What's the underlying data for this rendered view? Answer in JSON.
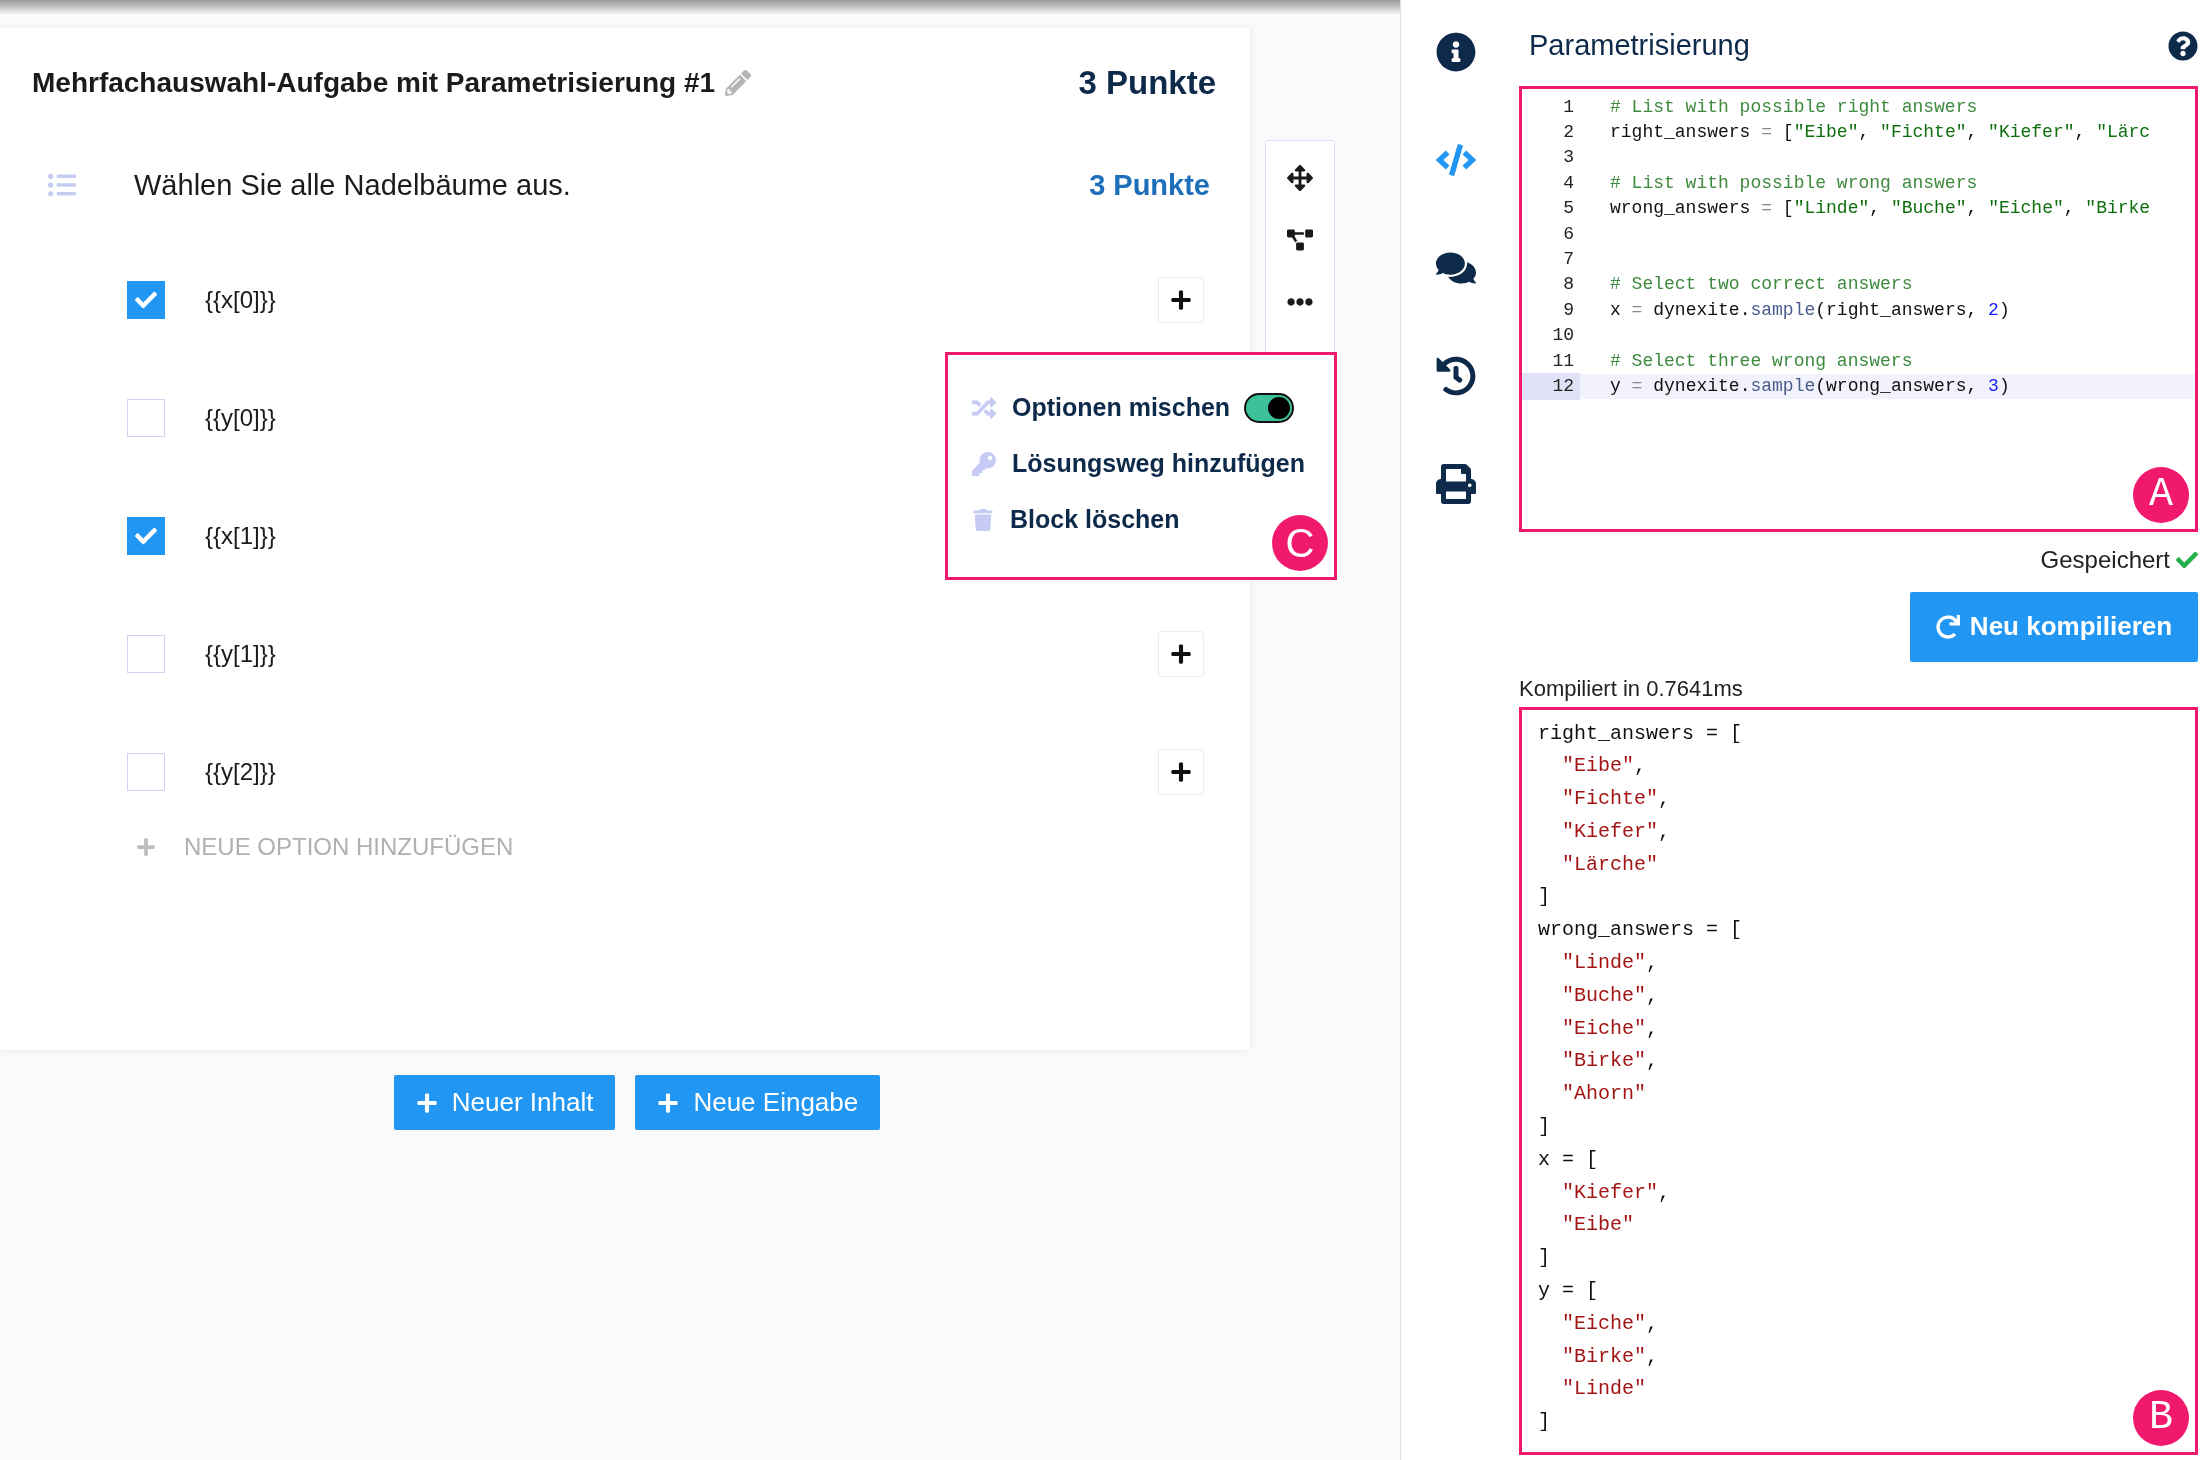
{
  "card": {
    "title": "Mehrfachauswahl-Aufgabe mit Parametrisierung #1",
    "points": "3 Punkte"
  },
  "question": {
    "text": "Wählen Sie alle Nadelbäume aus.",
    "points": "3 Punkte"
  },
  "options": [
    {
      "text": "{{x[0]}}",
      "checked": true
    },
    {
      "text": "{{y[0]}}",
      "checked": false
    },
    {
      "text": "{{x[1]}}",
      "checked": true
    },
    {
      "text": "{{y[1]}}",
      "checked": false
    },
    {
      "text": "{{y[2]}}",
      "checked": false
    }
  ],
  "new_option": "NEUE OPTION HINZUFÜGEN",
  "toolbar": [
    {
      "kind": "move"
    },
    {
      "kind": "diagram"
    },
    {
      "kind": "more"
    }
  ],
  "menu": {
    "badge": "C",
    "items": [
      {
        "kind": "shuffle",
        "text": "Optionen mischen",
        "on": true
      },
      {
        "kind": "solution",
        "text": "Lösungsweg hinzufügen"
      },
      {
        "kind": "delete",
        "text": "Block löschen"
      }
    ]
  },
  "buttons": [
    "Neuer Inhalt",
    "Neue Eingabe"
  ],
  "sidebar": [
    {
      "kind": "info",
      "selected": false
    },
    {
      "kind": "code",
      "selected": true
    },
    {
      "kind": "comments",
      "selected": false
    },
    {
      "kind": "history",
      "selected": false
    },
    {
      "kind": "print",
      "selected": false
    }
  ],
  "panel": {
    "title": "Parametrisierung"
  },
  "editor": {
    "badge": "A",
    "lines": [
      {
        "number": "1",
        "active": false,
        "tokens": [
          {
            "kind": "comment",
            "text": "# List with possible right answers"
          }
        ]
      },
      {
        "number": "2",
        "active": false,
        "tokens": [
          {
            "kind": "plain",
            "text": "right_answers "
          },
          {
            "kind": "op",
            "text": "="
          },
          {
            "kind": "plain",
            "text": " ["
          },
          {
            "kind": "string",
            "text": "\"Eibe\""
          },
          {
            "kind": "plain",
            "text": ", "
          },
          {
            "kind": "string",
            "text": "\"Fichte\""
          },
          {
            "kind": "plain",
            "text": ", "
          },
          {
            "kind": "string",
            "text": "\"Kiefer\""
          },
          {
            "kind": "plain",
            "text": ", "
          },
          {
            "kind": "string",
            "text": "\"Lärc"
          }
        ]
      },
      {
        "number": "3",
        "active": false
      },
      {
        "number": "4",
        "active": false,
        "tokens": [
          {
            "kind": "comment",
            "text": "# List with possible wrong answers"
          }
        ]
      },
      {
        "number": "5",
        "active": false,
        "tokens": [
          {
            "kind": "plain",
            "text": "wrong_answers "
          },
          {
            "kind": "op",
            "text": "="
          },
          {
            "kind": "plain",
            "text": " ["
          },
          {
            "kind": "string",
            "text": "\"Linde\""
          },
          {
            "kind": "plain",
            "text": ", "
          },
          {
            "kind": "string",
            "text": "\"Buche\""
          },
          {
            "kind": "plain",
            "text": ", "
          },
          {
            "kind": "string",
            "text": "\"Eiche\""
          },
          {
            "kind": "plain",
            "text": ", "
          },
          {
            "kind": "string",
            "text": "\"Birke"
          }
        ]
      },
      {
        "number": "6",
        "active": false
      },
      {
        "number": "7",
        "active": false
      },
      {
        "number": "8",
        "active": false,
        "tokens": [
          {
            "kind": "comment",
            "text": "# Select two correct answers"
          }
        ]
      },
      {
        "number": "9",
        "active": false,
        "tokens": [
          {
            "kind": "plain",
            "text": "x "
          },
          {
            "kind": "op",
            "text": "="
          },
          {
            "kind": "plain",
            "text": " dynexite."
          },
          {
            "kind": "method",
            "text": "sample"
          },
          {
            "kind": "plain",
            "text": "(right_answers, "
          },
          {
            "kind": "number",
            "text": "2"
          },
          {
            "kind": "plain",
            "text": ")"
          }
        ]
      },
      {
        "number": "10",
        "active": false
      },
      {
        "number": "11",
        "active": false,
        "tokens": [
          {
            "kind": "comment",
            "text": "# Select three wrong answers"
          }
        ]
      },
      {
        "number": "12",
        "active": true,
        "tokens": [
          {
            "kind": "plain",
            "text": "y "
          },
          {
            "kind": "op",
            "text": "="
          },
          {
            "kind": "plain",
            "text": " dynexite."
          },
          {
            "kind": "method",
            "text": "sample"
          },
          {
            "kind": "plain",
            "text": "(wrong_answers, "
          },
          {
            "kind": "number",
            "text": "3"
          },
          {
            "kind": "plain",
            "text": ")"
          }
        ]
      }
    ]
  },
  "status": "Gespeichert",
  "compile_button": "Neu kompilieren",
  "compile_time": "Kompiliert in 0.7641ms",
  "output": {
    "badge": "B",
    "blocks": [
      {
        "head": "right_answers = [",
        "items": [
          {
            "value": "\"Eibe\"",
            "sep": ","
          },
          {
            "value": "\"Fichte\"",
            "sep": ","
          },
          {
            "value": "\"Kiefer\"",
            "sep": ","
          },
          {
            "value": "\"Lärche\""
          }
        ],
        "close": "]"
      },
      {
        "head": "wrong_answers = [",
        "items": [
          {
            "value": "\"Linde\"",
            "sep": ","
          },
          {
            "value": "\"Buche\"",
            "sep": ","
          },
          {
            "value": "\"Eiche\"",
            "sep": ","
          },
          {
            "value": "\"Birke\"",
            "sep": ","
          },
          {
            "value": "\"Ahorn\""
          }
        ],
        "close": "]"
      },
      {
        "head": "x = [",
        "items": [
          {
            "value": "\"Kiefer\"",
            "sep": ","
          },
          {
            "value": "\"Eibe\""
          }
        ],
        "close": "]"
      },
      {
        "head": "y = [",
        "items": [
          {
            "value": "\"Eiche\"",
            "sep": ","
          },
          {
            "value": "\"Birke\"",
            "sep": ","
          },
          {
            "value": "\"Linde\""
          }
        ],
        "close": "]"
      }
    ]
  }
}
